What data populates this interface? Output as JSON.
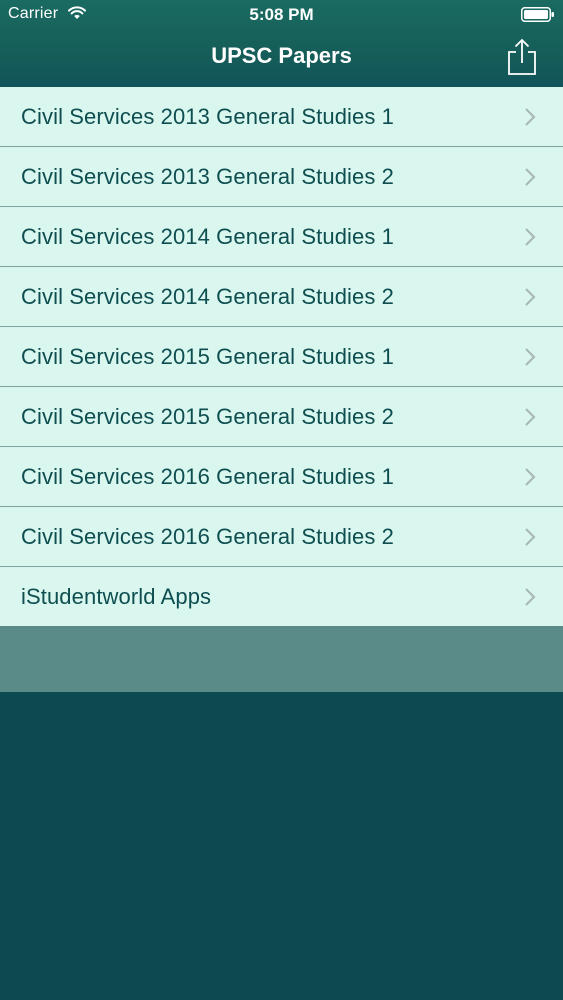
{
  "status_bar": {
    "carrier": "Carrier",
    "time": "5:08 PM",
    "icons": [
      "wifi-icon",
      "battery-icon"
    ]
  },
  "nav_bar": {
    "title": "UPSC Papers",
    "share_icon": "share-icon"
  },
  "list": {
    "items": [
      {
        "label": "Civil Services 2013 General Studies 1"
      },
      {
        "label": "Civil Services 2013 General Studies 2"
      },
      {
        "label": "Civil Services 2014 General Studies 1"
      },
      {
        "label": "Civil Services 2014 General Studies 2"
      },
      {
        "label": "Civil Services 2015 General Studies 1"
      },
      {
        "label": "Civil Services 2015 General Studies 2"
      },
      {
        "label": "Civil Services 2016 General Studies 1"
      },
      {
        "label": "Civil Services 2016 General Studies 2"
      },
      {
        "label": "iStudentworld Apps"
      }
    ]
  },
  "colors": {
    "header": "#165f59",
    "row_background": "#d9f7ef",
    "row_text": "#0f4e50",
    "separator": "#7ea3a0",
    "chevron": "#a9b9b6",
    "footer_band": "#5a8b88",
    "background": "#0b4a50"
  }
}
